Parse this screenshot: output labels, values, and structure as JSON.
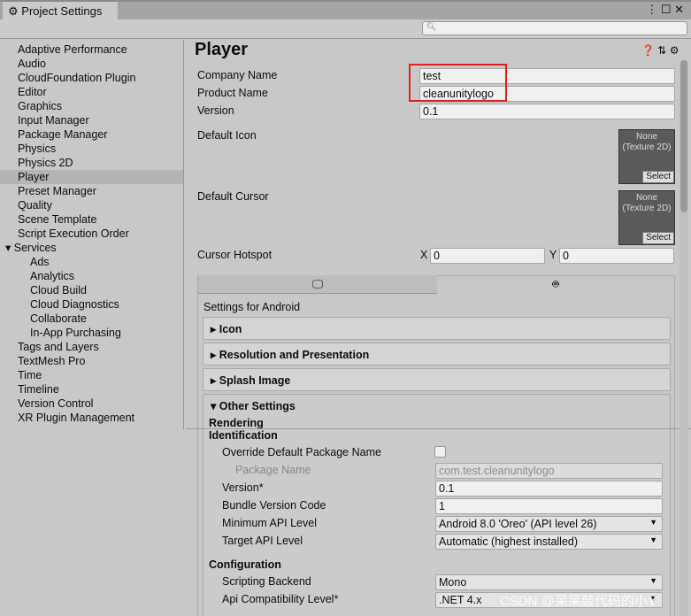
{
  "window": {
    "title": "Project Settings",
    "search_placeholder": ""
  },
  "sidebar": {
    "items": [
      {
        "label": "Adaptive Performance"
      },
      {
        "label": "Audio"
      },
      {
        "label": "CloudFoundation Plugin"
      },
      {
        "label": "Editor"
      },
      {
        "label": "Graphics"
      },
      {
        "label": "Input Manager"
      },
      {
        "label": "Package Manager"
      },
      {
        "label": "Physics"
      },
      {
        "label": "Physics 2D"
      },
      {
        "label": "Player",
        "selected": true
      },
      {
        "label": "Preset Manager"
      },
      {
        "label": "Quality"
      },
      {
        "label": "Scene Template"
      },
      {
        "label": "Script Execution Order"
      },
      {
        "label": "Services",
        "expanded": true
      },
      {
        "label": "Ads",
        "sub": true
      },
      {
        "label": "Analytics",
        "sub": true
      },
      {
        "label": "Cloud Build",
        "sub": true
      },
      {
        "label": "Cloud Diagnostics",
        "sub": true
      },
      {
        "label": "Collaborate",
        "sub": true
      },
      {
        "label": "In-App Purchasing",
        "sub": true
      },
      {
        "label": "Tags and Layers"
      },
      {
        "label": "TextMesh Pro"
      },
      {
        "label": "Time"
      },
      {
        "label": "Timeline"
      },
      {
        "label": "Version Control"
      },
      {
        "label": "XR Plugin Management"
      }
    ]
  },
  "player": {
    "title": "Player",
    "company_label": "Company Name",
    "company": "test",
    "product_label": "Product Name",
    "product": "cleanunitylogo",
    "version_label": "Version",
    "version": "0.1",
    "default_icon_label": "Default Icon",
    "default_cursor_label": "Default Cursor",
    "thumb_none": "None",
    "thumb_type": "(Texture 2D)",
    "thumb_select": "Select",
    "hotspot_label": "Cursor Hotspot",
    "x_label": "X",
    "x": "0",
    "y_label": "Y",
    "y": "0",
    "settings_for": "Settings for Android",
    "foldouts": [
      "Icon",
      "Resolution and Presentation",
      "Splash Image",
      "Other Settings"
    ],
    "rendering": "Rendering",
    "identification": "Identification",
    "override_label": "Override Default Package Name",
    "package_label": "Package Name",
    "package": "com.test.cleanunitylogo",
    "version2_label": "Version*",
    "version2": "0.1",
    "bundle_label": "Bundle Version Code",
    "bundle": "1",
    "min_api_label": "Minimum API Level",
    "min_api": "Android 8.0 'Oreo' (API level 26)",
    "target_api_label": "Target API Level",
    "target_api": "Automatic (highest installed)",
    "configuration": "Configuration",
    "backend_label": "Scripting Backend",
    "backend": "Mono",
    "api_compat_label": "Api Compatibility Level*",
    "api_compat": ".NET 4.x"
  },
  "watermark": "CSDN @呆呆敲代码的小Y",
  "colors": {
    "highlight": "#e02020",
    "selected": "#b4b4b4"
  }
}
